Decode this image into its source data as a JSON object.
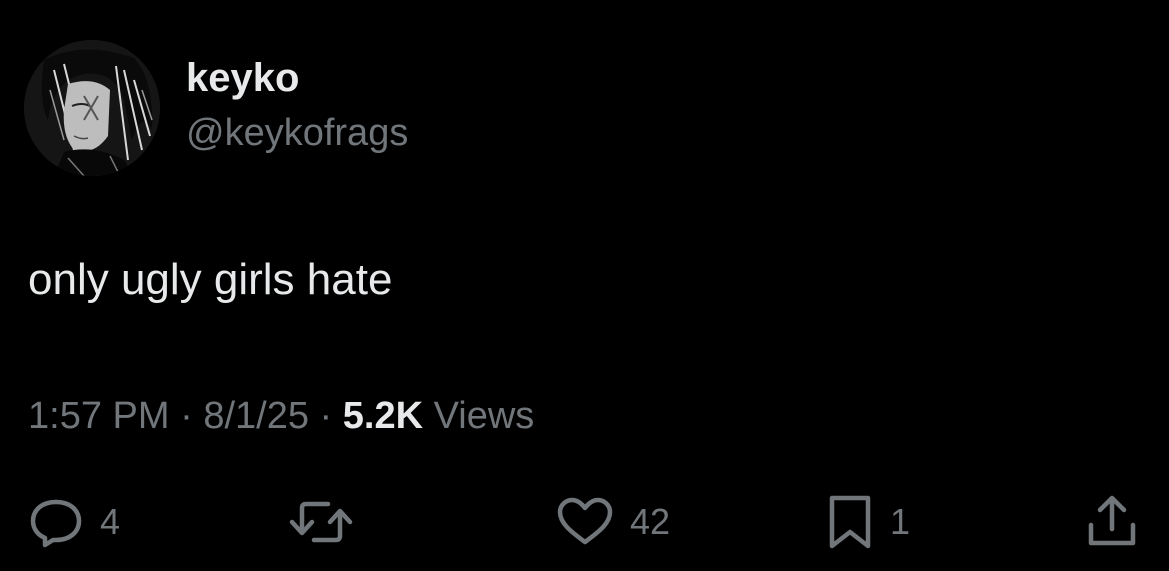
{
  "tweet": {
    "author": {
      "display_name": "keyko",
      "handle": "@keykofrags"
    },
    "text": "only ugly girls hate",
    "meta": {
      "time": "1:57 PM",
      "separator": "·",
      "date": "8/1/25",
      "views_count": "5.2K",
      "views_label": "Views"
    },
    "actions": {
      "replies": "4",
      "retweets": "",
      "likes": "42",
      "bookmarks": "1"
    }
  },
  "colors": {
    "background": "#000000",
    "primary_text": "#e7e9ea",
    "secondary_text": "#71767b"
  },
  "icons": [
    "reply-icon",
    "retweet-icon",
    "like-icon",
    "bookmark-icon",
    "share-icon"
  ]
}
